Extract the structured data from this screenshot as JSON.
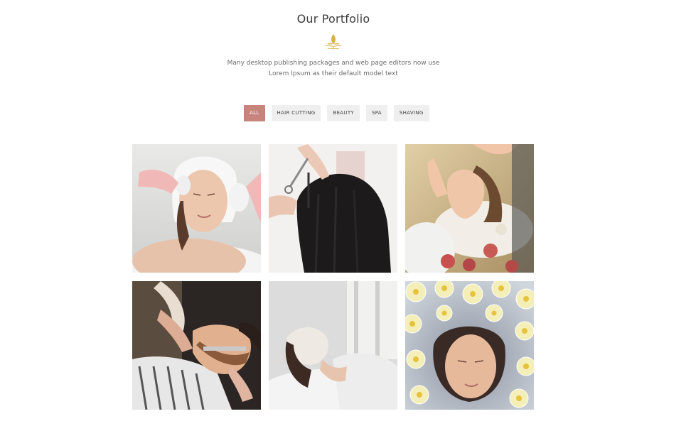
{
  "portfolio": {
    "title": "Our Portfolio",
    "description_line1": "Many desktop publishing packages and web page editors now use",
    "description_line2": "Lorem Ipsum as their default model text",
    "ornament_icon": "gold-lotus-flourish-icon",
    "accent_color": "#c7847c",
    "ornament_color": "#d9b04a"
  },
  "filters": [
    {
      "label": "ALL",
      "active": true
    },
    {
      "label": "HAIR CUTTING",
      "active": false
    },
    {
      "label": "BEAUTY",
      "active": false
    },
    {
      "label": "SPA",
      "active": false
    },
    {
      "label": "SHAVING",
      "active": false
    }
  ],
  "gallery": [
    {
      "subject": "facial-cleansing-photo"
    },
    {
      "subject": "hair-cutting-photo"
    },
    {
      "subject": "face-massage-photo"
    },
    {
      "subject": "beard-shaving-photo"
    },
    {
      "subject": "face-mask-photo"
    },
    {
      "subject": "flower-bath-photo"
    }
  ]
}
